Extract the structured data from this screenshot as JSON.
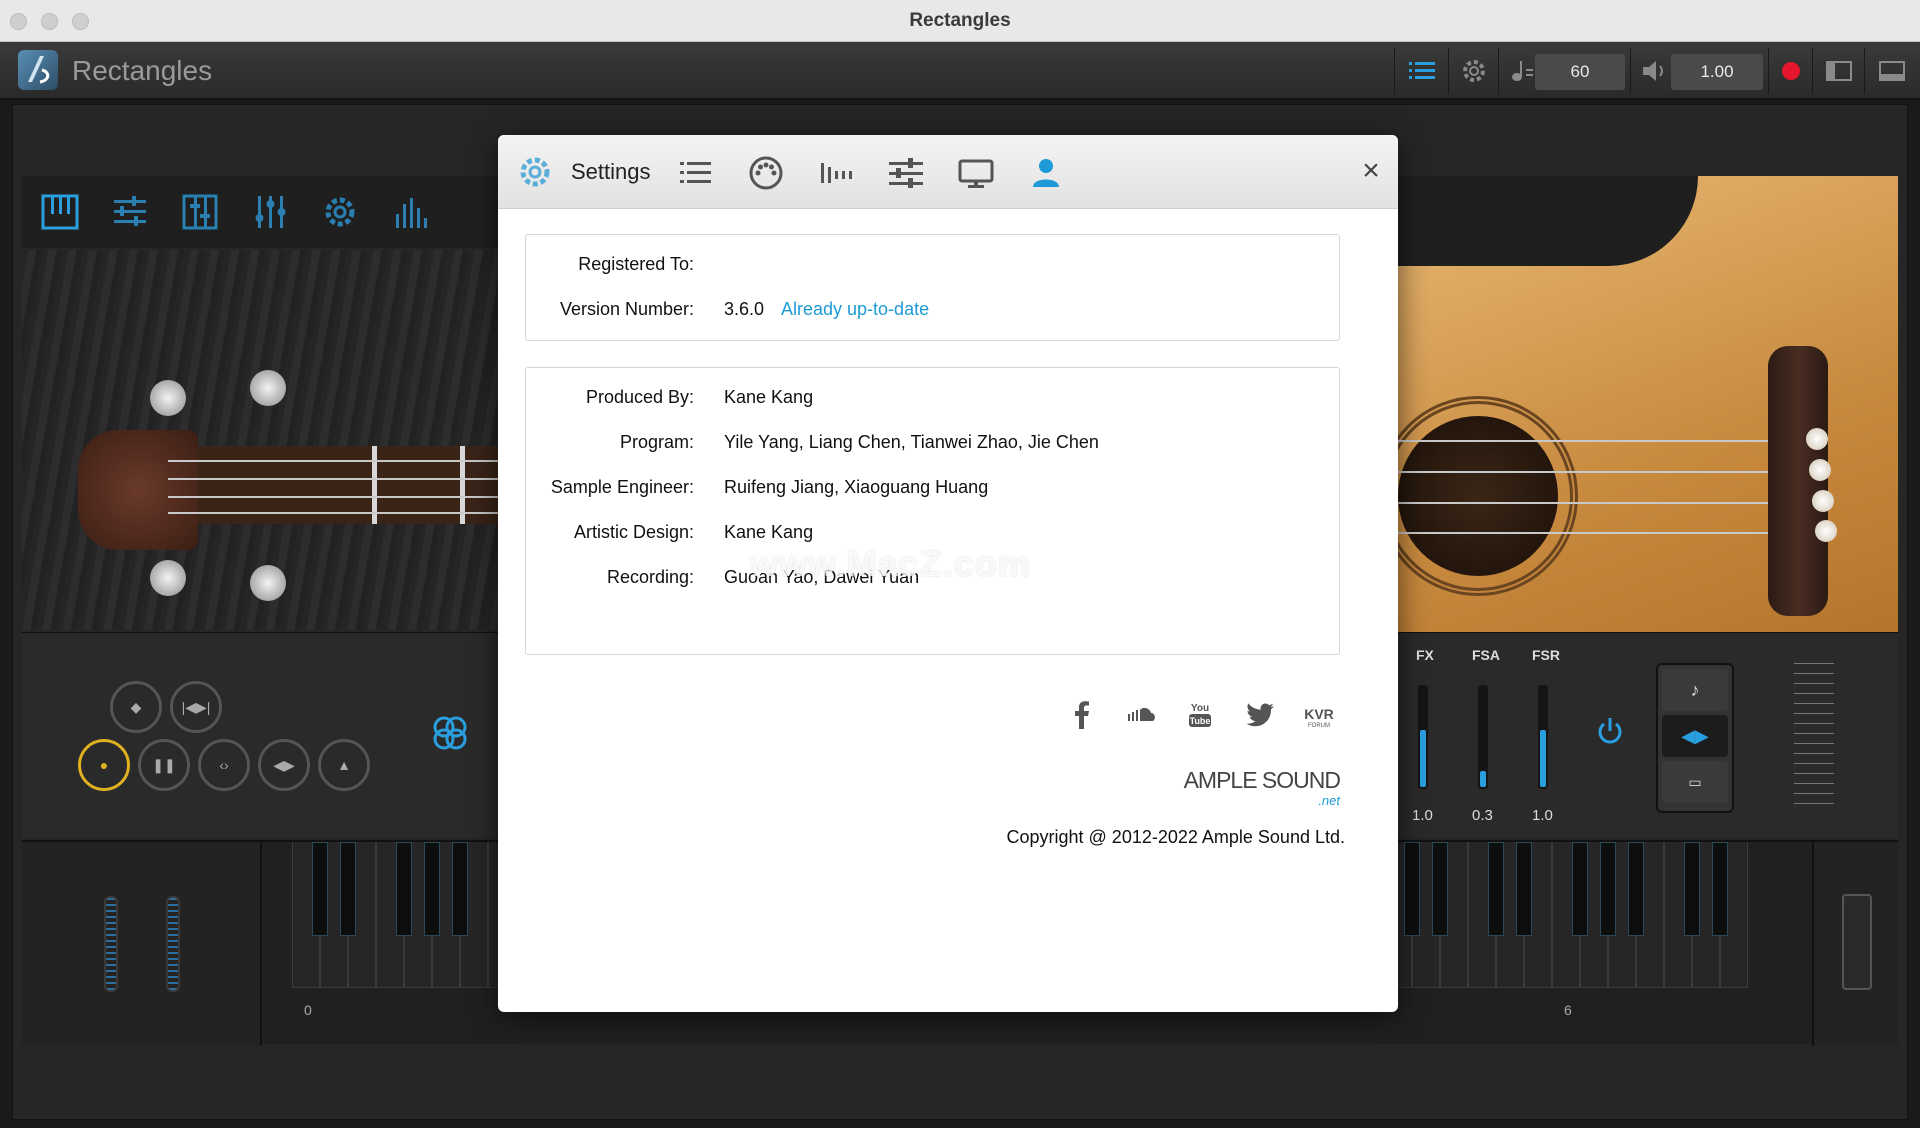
{
  "window": {
    "title": "Rectangles"
  },
  "plugin_bar": {
    "app_name": "Rectangles",
    "tempo": "60",
    "volume": "1.00"
  },
  "dialog": {
    "title": "Settings",
    "info": {
      "registered_to_label": "Registered To:",
      "registered_to_value": "",
      "version_label": "Version Number:",
      "version_value": "3.6.0",
      "update_status": "Already up-to-date"
    },
    "credits": [
      {
        "label": "Produced By:",
        "value": "Kane Kang"
      },
      {
        "label": "Program:",
        "value": "Yile Yang, Liang Chen, Tianwei Zhao, Jie Chen"
      },
      {
        "label": "Sample Engineer:",
        "value": "Ruifeng Jiang, Xiaoguang Huang"
      },
      {
        "label": "Artistic Design:",
        "value": "Kane Kang"
      },
      {
        "label": "Recording:",
        "value": "Guoan Yao, Dawei Yuan"
      }
    ],
    "social_icons": [
      "facebook-icon",
      "soundcloud-icon",
      "youtube-icon",
      "twitter-icon",
      "kvr-forum-icon"
    ],
    "logo_text": "AMPLE SOUND",
    "logo_sub": ".net",
    "copyright": "Copyright @ 2012-2022 Ample Sound Ltd.",
    "watermark": "www.MacZ.com"
  },
  "fx_panel": {
    "labels": [
      "FX",
      "FSA",
      "FSR"
    ],
    "values": [
      "1.0",
      "0.3",
      "1.0"
    ],
    "levels": [
      0.55,
      0.15,
      0.55
    ]
  },
  "keyboard": {
    "octave_labels": [
      "0",
      "6"
    ]
  },
  "colors": {
    "accent": "#1e9bd6",
    "record": "#e6162e",
    "dialog_bg": "#ffffff"
  }
}
